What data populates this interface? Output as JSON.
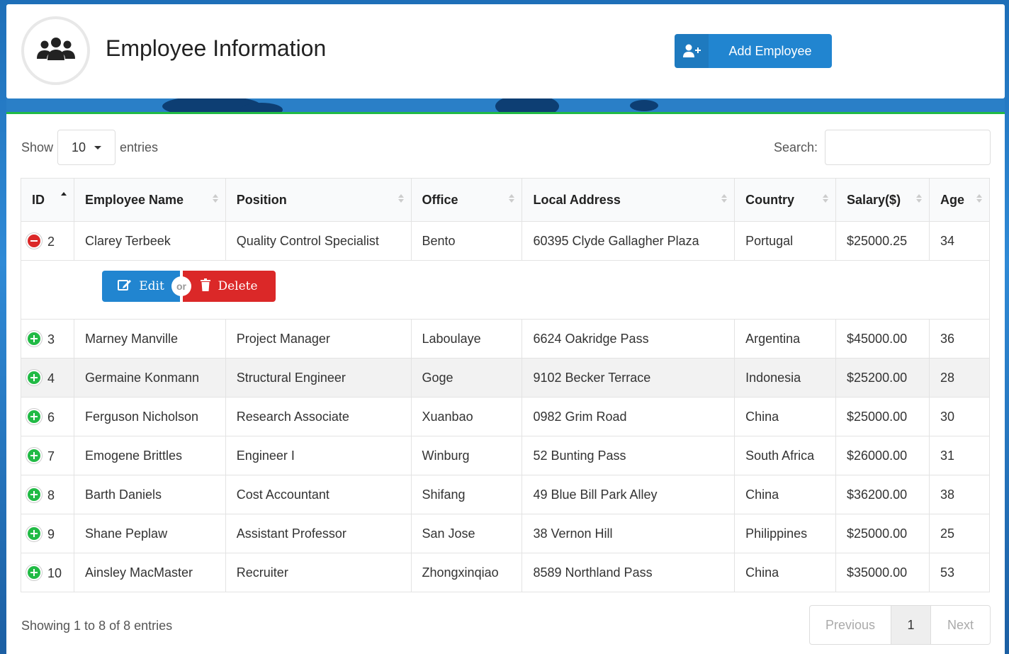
{
  "header": {
    "title": "Employee Information",
    "add_button_label": "Add Employee"
  },
  "controls": {
    "show_label": "Show",
    "entries_value": "10",
    "entries_label": "entries",
    "search_label": "Search:",
    "search_value": ""
  },
  "table": {
    "columns": [
      "ID",
      "Employee Name",
      "Position",
      "Office",
      "Local Address",
      "Country",
      "Salary($)",
      "Age"
    ],
    "rows": [
      {
        "id": "2",
        "name": "Clarey Terbeek",
        "position": "Quality Control Specialist",
        "office": "Bento",
        "address": "60395 Clyde Gallagher Plaza",
        "country": "Portugal",
        "salary": "$25000.25",
        "age": "34"
      },
      {
        "id": "3",
        "name": "Marney Manville",
        "position": "Project Manager",
        "office": "Laboulaye",
        "address": "6624 Oakridge Pass",
        "country": "Argentina",
        "salary": "$45000.00",
        "age": "36"
      },
      {
        "id": "4",
        "name": "Germaine Konmann",
        "position": "Structural Engineer",
        "office": "Goge",
        "address": "9102 Becker Terrace",
        "country": "Indonesia",
        "salary": "$25200.00",
        "age": "28"
      },
      {
        "id": "6",
        "name": "Ferguson Nicholson",
        "position": "Research Associate",
        "office": "Xuanbao",
        "address": "0982 Grim Road",
        "country": "China",
        "salary": "$25000.00",
        "age": "30"
      },
      {
        "id": "7",
        "name": "Emogene Brittles",
        "position": "Engineer I",
        "office": "Winburg",
        "address": "52 Bunting Pass",
        "country": "South Africa",
        "salary": "$26000.00",
        "age": "31"
      },
      {
        "id": "8",
        "name": "Barth Daniels",
        "position": "Cost Accountant",
        "office": "Shifang",
        "address": "49 Blue Bill Park Alley",
        "country": "China",
        "salary": "$36200.00",
        "age": "38"
      },
      {
        "id": "9",
        "name": "Shane Peplaw",
        "position": "Assistant Professor",
        "office": "San Jose",
        "address": "38 Vernon Hill",
        "country": "Philippines",
        "salary": "$25000.00",
        "age": "25"
      },
      {
        "id": "10",
        "name": "Ainsley MacMaster",
        "position": "Recruiter",
        "office": "Zhongxinqiao",
        "address": "8589 Northland Pass",
        "country": "China",
        "salary": "$35000.00",
        "age": "53"
      }
    ],
    "row_actions": {
      "edit_label": "Edit",
      "or_label": "or",
      "delete_label": "Delete"
    }
  },
  "footer": {
    "info": "Showing 1 to 8 of 8 entries",
    "previous_label": "Previous",
    "current_page": "1",
    "next_label": "Next"
  },
  "colors": {
    "primary": "#2185d0",
    "danger": "#db2828",
    "success": "#21ba45"
  },
  "icons": {
    "header": "users-icon",
    "add": "user-plus-icon",
    "edit": "edit-icon",
    "delete": "trash-icon"
  }
}
